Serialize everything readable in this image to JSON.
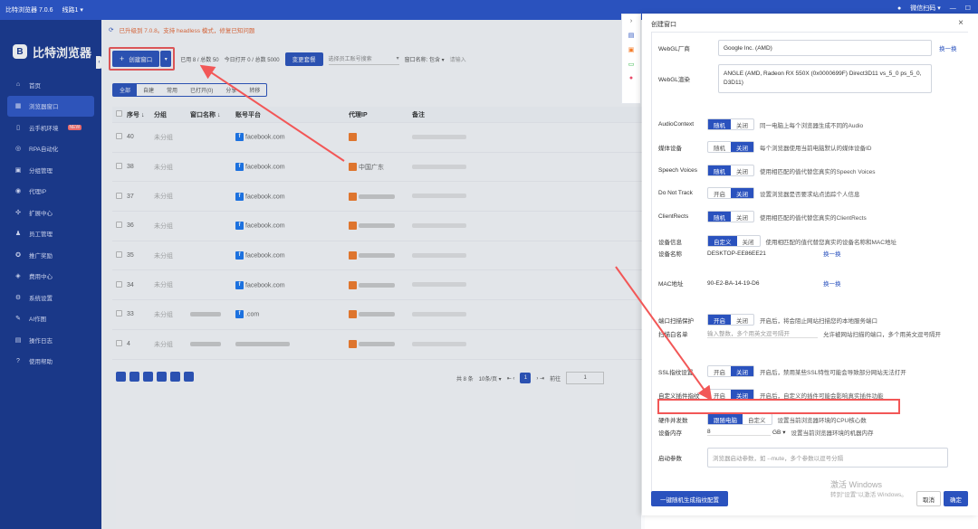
{
  "titlebar": {
    "title": "比特浏览器 7.0.6",
    "line": "线路1 ▾",
    "user": "微信扫码 ▾"
  },
  "sidebar": {
    "brand": "比特浏览器",
    "items": [
      {
        "icon": "⌂",
        "label": "首页"
      },
      {
        "icon": "▦",
        "label": "浏览器窗口"
      },
      {
        "icon": "▯",
        "label": "云手机环境",
        "badge": "NEW"
      },
      {
        "icon": "◎",
        "label": "RPA自动化"
      },
      {
        "icon": "▣",
        "label": "分组管理"
      },
      {
        "icon": "◉",
        "label": "代理IP"
      },
      {
        "icon": "✣",
        "label": "扩展中心"
      },
      {
        "icon": "♟",
        "label": "员工管理"
      },
      {
        "icon": "✪",
        "label": "推广奖励"
      },
      {
        "icon": "◈",
        "label": "费用中心"
      },
      {
        "icon": "⚙",
        "label": "系统设置"
      },
      {
        "icon": "✎",
        "label": "AI作图"
      },
      {
        "icon": "▤",
        "label": "操作日志"
      },
      {
        "icon": "?",
        "label": "使用帮助"
      }
    ]
  },
  "notice": "已升级到 7.0.8。支持 headless 模式，修复已知问题",
  "toolbar": {
    "create": "创建窗口",
    "used": "已用 8 / 总数 50",
    "opened": "今日打开 0 / 总数 5000",
    "change": "变更套餐",
    "employee_placeholder": "选择员工账号搜索",
    "name_filter": "窗口名称: 包含 ▾",
    "name_placeholder": "请输入"
  },
  "filters": [
    "全部",
    "自建",
    "常用",
    "已打开(0)",
    "分享",
    "转移"
  ],
  "table": {
    "headers": [
      "序号 ↓",
      "分组",
      "窗口名称 ↓",
      "账号平台",
      "代理IP",
      "备注"
    ],
    "rows": [
      {
        "no": "40",
        "group": "未分组",
        "platform": "facebook.com"
      },
      {
        "no": "38",
        "group": "未分组",
        "platform": "facebook.com",
        "ip": "中国广东"
      },
      {
        "no": "37",
        "group": "未分组",
        "platform": "facebook.com"
      },
      {
        "no": "36",
        "group": "未分组",
        "platform": "facebook.com"
      },
      {
        "no": "35",
        "group": "未分组",
        "platform": "facebook.com"
      },
      {
        "no": "34",
        "group": "未分组",
        "platform": "facebook.com"
      },
      {
        "no": "33",
        "group": "未分组",
        "platform": ".com"
      },
      {
        "no": "4",
        "group": "未分组",
        "platform": ""
      }
    ]
  },
  "pager": {
    "total": "共 8 条",
    "size": "10条/页 ▾",
    "page": "1",
    "goto": "前往",
    "page_input": "1"
  },
  "dialog": {
    "title": "创建窗口",
    "close": "×",
    "webgl_vendor": {
      "label": "WebGL厂商",
      "value": "Google Inc. (AMD)",
      "link": "换一换"
    },
    "webgl_render": {
      "label": "WebGL渲染",
      "value": "ANGLE (AMD, Radeon RX 550X (0x0000699F) Direct3D11 vs_5_0 ps_5_0, D3D11)"
    },
    "audio": {
      "label": "AudioContext",
      "a": "随机",
      "b": "关闭",
      "desc": "同一电脑上每个浏览器生成不同的Audio"
    },
    "media": {
      "label": "媒体设备",
      "a": "随机",
      "b": "关闭",
      "desc": "每个浏览器使用当前电脑默认的媒体设备ID"
    },
    "speech": {
      "label": "Speech Voices",
      "a": "随机",
      "b": "关闭",
      "desc": "使用相匹配的值代替您真实的Speech Voices"
    },
    "dnt": {
      "label": "Do Not Track",
      "a": "开启",
      "b": "关闭",
      "desc": "设置浏览器是否要求站点追踪个人信息"
    },
    "rects": {
      "label": "ClientRects",
      "a": "随机",
      "b": "关闭",
      "desc": "使用相匹配的值代替您真实的ClientRects"
    },
    "devinfo": {
      "label": "设备信息",
      "a": "自定义",
      "b": "关闭",
      "desc": "使用相匹配的值代替您真实的设备名称和MAC地址"
    },
    "devname": {
      "label": "设备名称",
      "value": "DESKTOP-EE86EE21",
      "link": "换一换"
    },
    "mac": {
      "label": "MAC地址",
      "value": "90-E2-BA-14-19-D6",
      "link": "换一换"
    },
    "portscan": {
      "label": "端口扫描保护",
      "a": "开启",
      "b": "关闭",
      "desc": "开启后，将会阻止网站扫描您的本地服务端口"
    },
    "whitelist": {
      "label": "扫描白名单",
      "placeholder": "输入整数，多个用英文逗号隔开",
      "desc": "允许被网站扫描的端口，多个用英文逗号隔开"
    },
    "ssl": {
      "label": "SSL指纹设置",
      "a": "开启",
      "b": "关闭",
      "desc": "开启后，禁用某些SSL特性可能会导致部分网站无法打开"
    },
    "plugin": {
      "label": "自定义插件指纹",
      "a": "开启",
      "b": "关闭",
      "desc": "开启后，自定义的插件可能会影响真实插件功能"
    },
    "hardware": {
      "label": "硬件并发数",
      "a": "跟随电脑",
      "b": "自定义",
      "desc": "设置当前浏览器环境的CPU核心数"
    },
    "memory": {
      "label": "设备内存",
      "value": "8",
      "unit": "GB ▾",
      "desc": "设置当前浏览器环境的机器内存"
    },
    "launch": {
      "label": "启动参数",
      "placeholder": "浏览器启动参数，如 --mute，多个参数以逗号分隔"
    },
    "footer": {
      "random": "一键随机生成指纹配置",
      "cancel": "取消",
      "ok": "确定"
    }
  },
  "watermark": {
    "line1": "激活 Windows",
    "line2": "转到\"设置\"以激活 Windows。"
  }
}
